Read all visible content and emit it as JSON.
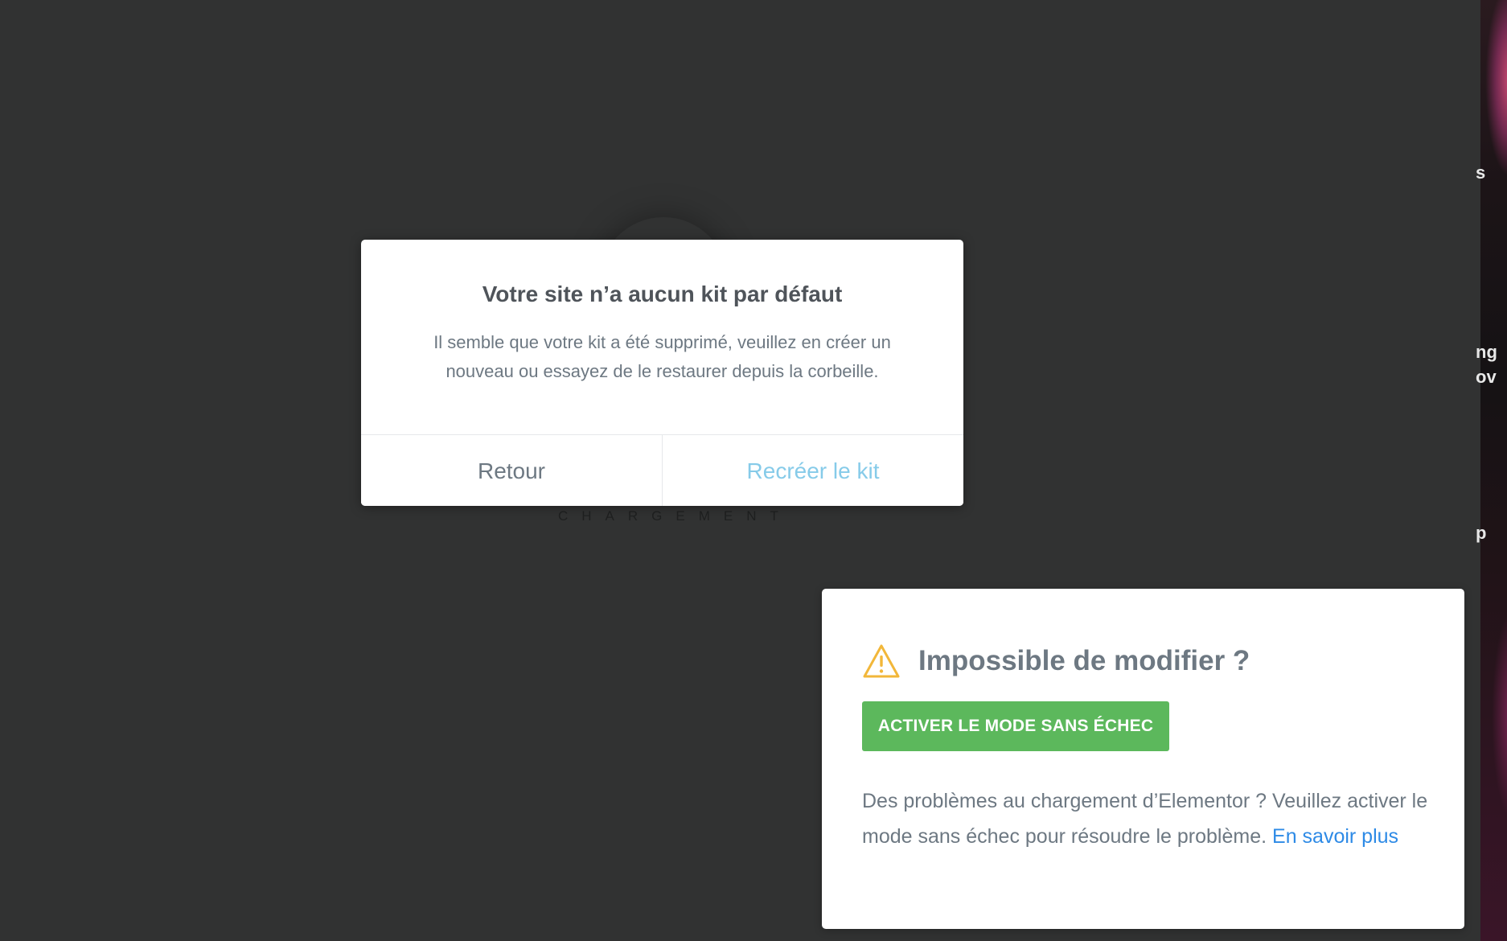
{
  "loader": {
    "text": "CHARGEMENT"
  },
  "dialog": {
    "title": "Votre site n’a aucun kit par défaut",
    "message": "Il semble que votre kit a été supprimé, veuillez en créer un nouveau ou essayez de le restaurer depuis la corbeille.",
    "back_label": "Retour",
    "recreate_label": "Recréer le kit"
  },
  "safe_mode": {
    "icon": "warning-triangle-icon",
    "title": "Impossible de modifier ?",
    "button_label": "ACTIVER LE MODE SANS ÉCHEC",
    "description": "Des problèmes au chargement d’Elementor ? Veuillez activer le mode sans échec pour résoudre le problème.",
    "link_label": "En savoir plus"
  },
  "side_fragments": [
    "s",
    "ng",
    "ov",
    "p"
  ],
  "colors": {
    "background": "#313232",
    "success": "#5cb85c",
    "link": "#2d8ae6",
    "recreate_text": "#86cbe9",
    "warning": "#f2b73a"
  }
}
